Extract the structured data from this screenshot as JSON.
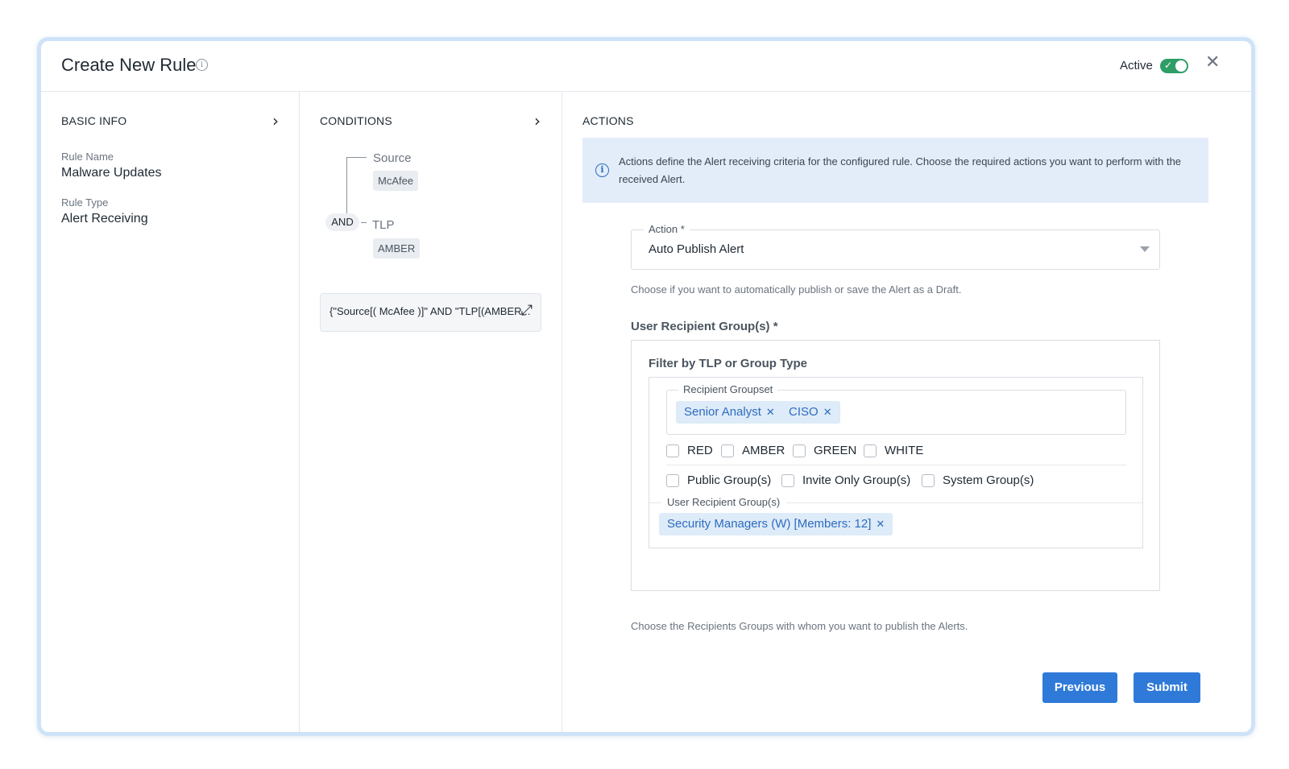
{
  "header": {
    "title": "Create New Rule",
    "info_icon": "info-icon",
    "active_label": "Active",
    "toggle_on": true,
    "close_icon": "close-icon"
  },
  "basic_info": {
    "heading": "BASIC INFO",
    "rule_name_label": "Rule Name",
    "rule_name_value": "Malware Updates",
    "rule_type_label": "Rule Type",
    "rule_type_value": "Alert Receiving"
  },
  "conditions": {
    "heading": "CONDITIONS",
    "operator": "AND",
    "items": [
      {
        "label": "Source",
        "value": "McAfee"
      },
      {
        "label": "TLP",
        "value": "AMBER"
      }
    ],
    "expression": "{\"Source[( McAfee )]\" AND \"TLP[(AMBER...",
    "expand_icon": "expand-icon"
  },
  "actions": {
    "heading": "ACTIONS",
    "banner_text": "Actions define the Alert receiving criteria for the configured rule. Choose the required actions you want to perform with the received Alert.",
    "action_label": "Action *",
    "action_value": "Auto Publish Alert",
    "action_help": "Choose if you want to automatically publish or save the Alert as a Draft.",
    "recipient_title": "User Recipient Group(s) *",
    "filter_title": "Filter by TLP or Group Type",
    "groupset_label": "Recipient Groupset",
    "groupset_tags": [
      "Senior Analyst",
      "CISO"
    ],
    "tlp_options": [
      "RED",
      "AMBER",
      "GREEN",
      "WHITE"
    ],
    "group_type_options": [
      "Public Group(s)",
      "Invite Only Group(s)",
      "System Group(s)"
    ],
    "user_groups_label": "User Recipient Group(s)",
    "user_groups_tags": [
      "Security Managers (W) [Members: 12]"
    ],
    "recipient_help": "Choose the Recipients Groups with whom you want to publish the Alerts."
  },
  "footer": {
    "previous_label": "Previous",
    "submit_label": "Submit"
  },
  "colors": {
    "accent": "#2f7ad9",
    "toggle_active": "#2f9e66",
    "banner_bg": "#e3edfa",
    "tag_bg": "#deebf8"
  }
}
